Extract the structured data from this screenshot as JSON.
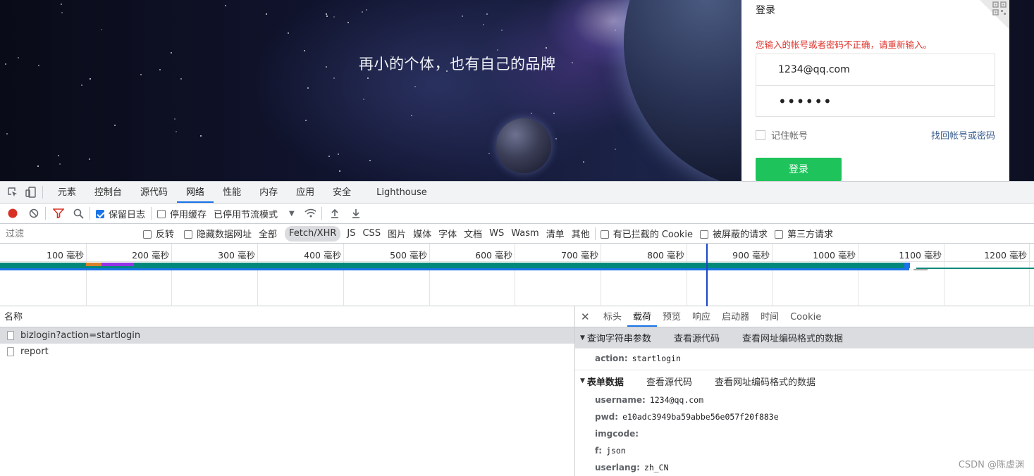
{
  "webpage": {
    "slogan": "再小的个体，也有自己的品牌",
    "login": {
      "title": "登录",
      "error": "您输入的帐号或者密码不正确，请重新输入。",
      "username": "1234@qq.com",
      "password_mask": "••••••",
      "remember_label": "记住帐号",
      "forgot_label": "找回帐号或密码",
      "submit_label": "登录"
    }
  },
  "devtools": {
    "tabs": [
      "元素",
      "控制台",
      "源代码",
      "网络",
      "性能",
      "内存",
      "应用",
      "安全",
      "Lighthouse"
    ],
    "active_tab": "网络",
    "toolbar": {
      "preserve_log": "保留日志",
      "preserve_log_checked": true,
      "disable_cache": "停用缓存",
      "disable_cache_checked": false,
      "throttle": "已停用节流模式"
    },
    "filter": {
      "placeholder": "过滤",
      "invert": "反转",
      "hide_data_urls": "隐藏数据网址",
      "types": [
        "全部",
        "Fetch/XHR",
        "JS",
        "CSS",
        "图片",
        "媒体",
        "字体",
        "文档",
        "WS",
        "Wasm",
        "清单",
        "其他"
      ],
      "active_type": "Fetch/XHR",
      "blocked_cookies": "有已拦截的 Cookie",
      "blocked_requests": "被屏蔽的请求",
      "third_party": "第三方请求"
    },
    "timeline": {
      "ticks": [
        "100 毫秒",
        "200 毫秒",
        "300 毫秒",
        "400 毫秒",
        "500 毫秒",
        "600 毫秒",
        "700 毫秒",
        "800 毫秒",
        "900 毫秒",
        "1000 毫秒",
        "1100 毫秒",
        "1200 毫秒"
      ]
    },
    "requests": {
      "column_name": "名称",
      "items": [
        {
          "name": "bizlogin?action=startlogin",
          "selected": true
        },
        {
          "name": "report",
          "selected": false
        }
      ]
    },
    "detail": {
      "tabs": [
        "标头",
        "载荷",
        "预览",
        "响应",
        "启动器",
        "时间",
        "Cookie"
      ],
      "active_tab": "载荷",
      "query_section": {
        "title": "查询字符串参数",
        "view_source": "查看源代码",
        "view_url_encoded": "查看网址编码格式的数据",
        "params": [
          {
            "key": "action:",
            "value": "startlogin"
          }
        ]
      },
      "form_section": {
        "title": "表单数据",
        "view_source": "查看源代码",
        "view_url_encoded": "查看网址编码格式的数据",
        "params": [
          {
            "key": "username:",
            "value": "1234@qq.com"
          },
          {
            "key": "pwd:",
            "value": "e10adc3949ba59abbe56e057f20f883e"
          },
          {
            "key": "imgcode:",
            "value": ""
          },
          {
            "key": "f:",
            "value": "json"
          },
          {
            "key": "userlang:",
            "value": "zh_CN"
          }
        ]
      }
    }
  },
  "watermark": "CSDN @陈虚渊"
}
